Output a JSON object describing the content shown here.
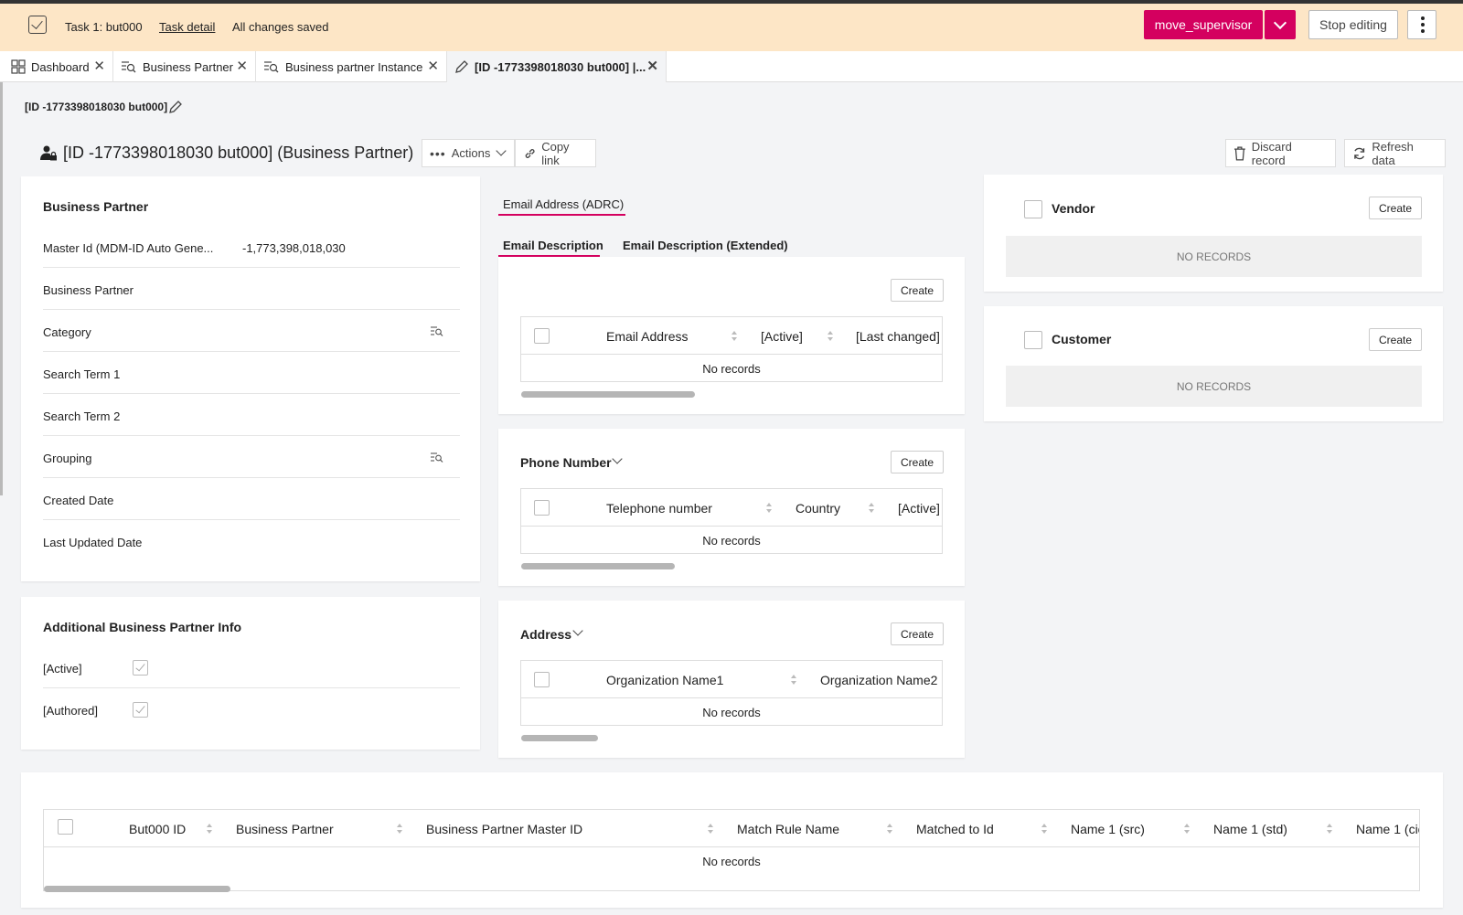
{
  "task": {
    "title": "Task 1: but000",
    "detail_link": "Task detail",
    "status": "All changes saved",
    "primary_button": "move_supervisor",
    "stop_button": "Stop editing"
  },
  "tabs": [
    {
      "label": "Dashboard",
      "icon": "dashboard-icon"
    },
    {
      "label": "Business Partner",
      "icon": "search-list-icon"
    },
    {
      "label": "Business partner Instance",
      "icon": "search-list-icon"
    },
    {
      "label": "[ID -1773398018030 but000] |...",
      "icon": "edit-icon",
      "active": true
    }
  ],
  "breadcrumb": "[ID -1773398018030 but000]",
  "header": {
    "title": "[ID -1773398018030 but000]  (Business Partner)",
    "actions_label": "Actions",
    "copy_link_label": "Copy link",
    "discard_label": "Discard record",
    "refresh_label": "Refresh data"
  },
  "business_partner": {
    "title": "Business Partner",
    "fields": [
      {
        "label": "Master Id (MDM-ID Auto Gene...",
        "value": "-1,773,398,018,030"
      },
      {
        "label": "Business Partner",
        "value": ""
      },
      {
        "label": "Category",
        "value": "",
        "lookup": true
      },
      {
        "label": "Search Term 1",
        "value": ""
      },
      {
        "label": "Search Term 2",
        "value": ""
      },
      {
        "label": "Grouping",
        "value": "",
        "lookup": true
      },
      {
        "label": "Created Date",
        "value": ""
      },
      {
        "label": "Last Updated Date",
        "value": ""
      }
    ]
  },
  "additional_info": {
    "title": "Additional Business Partner Info",
    "fields": [
      {
        "label": "[Active]",
        "checked": true
      },
      {
        "label": "[Authored]",
        "checked": true
      }
    ]
  },
  "email": {
    "section_tab": "Email Address (ADRC)",
    "subtabs": [
      "Email Description",
      "Email Description (Extended)"
    ],
    "create_label": "Create",
    "columns": [
      "Email Address",
      "[Active]",
      "[Last changed]"
    ],
    "no_records": "No records"
  },
  "phone": {
    "title": "Phone Number",
    "create_label": "Create",
    "columns": [
      "Telephone number",
      "Country",
      "[Active]"
    ],
    "no_records": "No records"
  },
  "address": {
    "title": "Address",
    "create_label": "Create",
    "columns": [
      "Organization Name1",
      "Organization Name2"
    ],
    "no_records": "No records"
  },
  "vendor": {
    "title": "Vendor",
    "create_label": "Create",
    "empty": "NO RECORDS"
  },
  "customer": {
    "title": "Customer",
    "create_label": "Create",
    "empty": "NO RECORDS"
  },
  "bottom_table": {
    "columns": [
      "But000 ID",
      "Business Partner",
      "Business Partner Master ID",
      "Match Rule Name",
      "Matched to Id",
      "Name 1 (src)",
      "Name 1 (std)",
      "Name 1 (cic"
    ],
    "no_records": "No records"
  },
  "colors": {
    "accent": "#d4005f",
    "taskbar": "#fde6c6",
    "page_bg": "#f3f4f6"
  }
}
